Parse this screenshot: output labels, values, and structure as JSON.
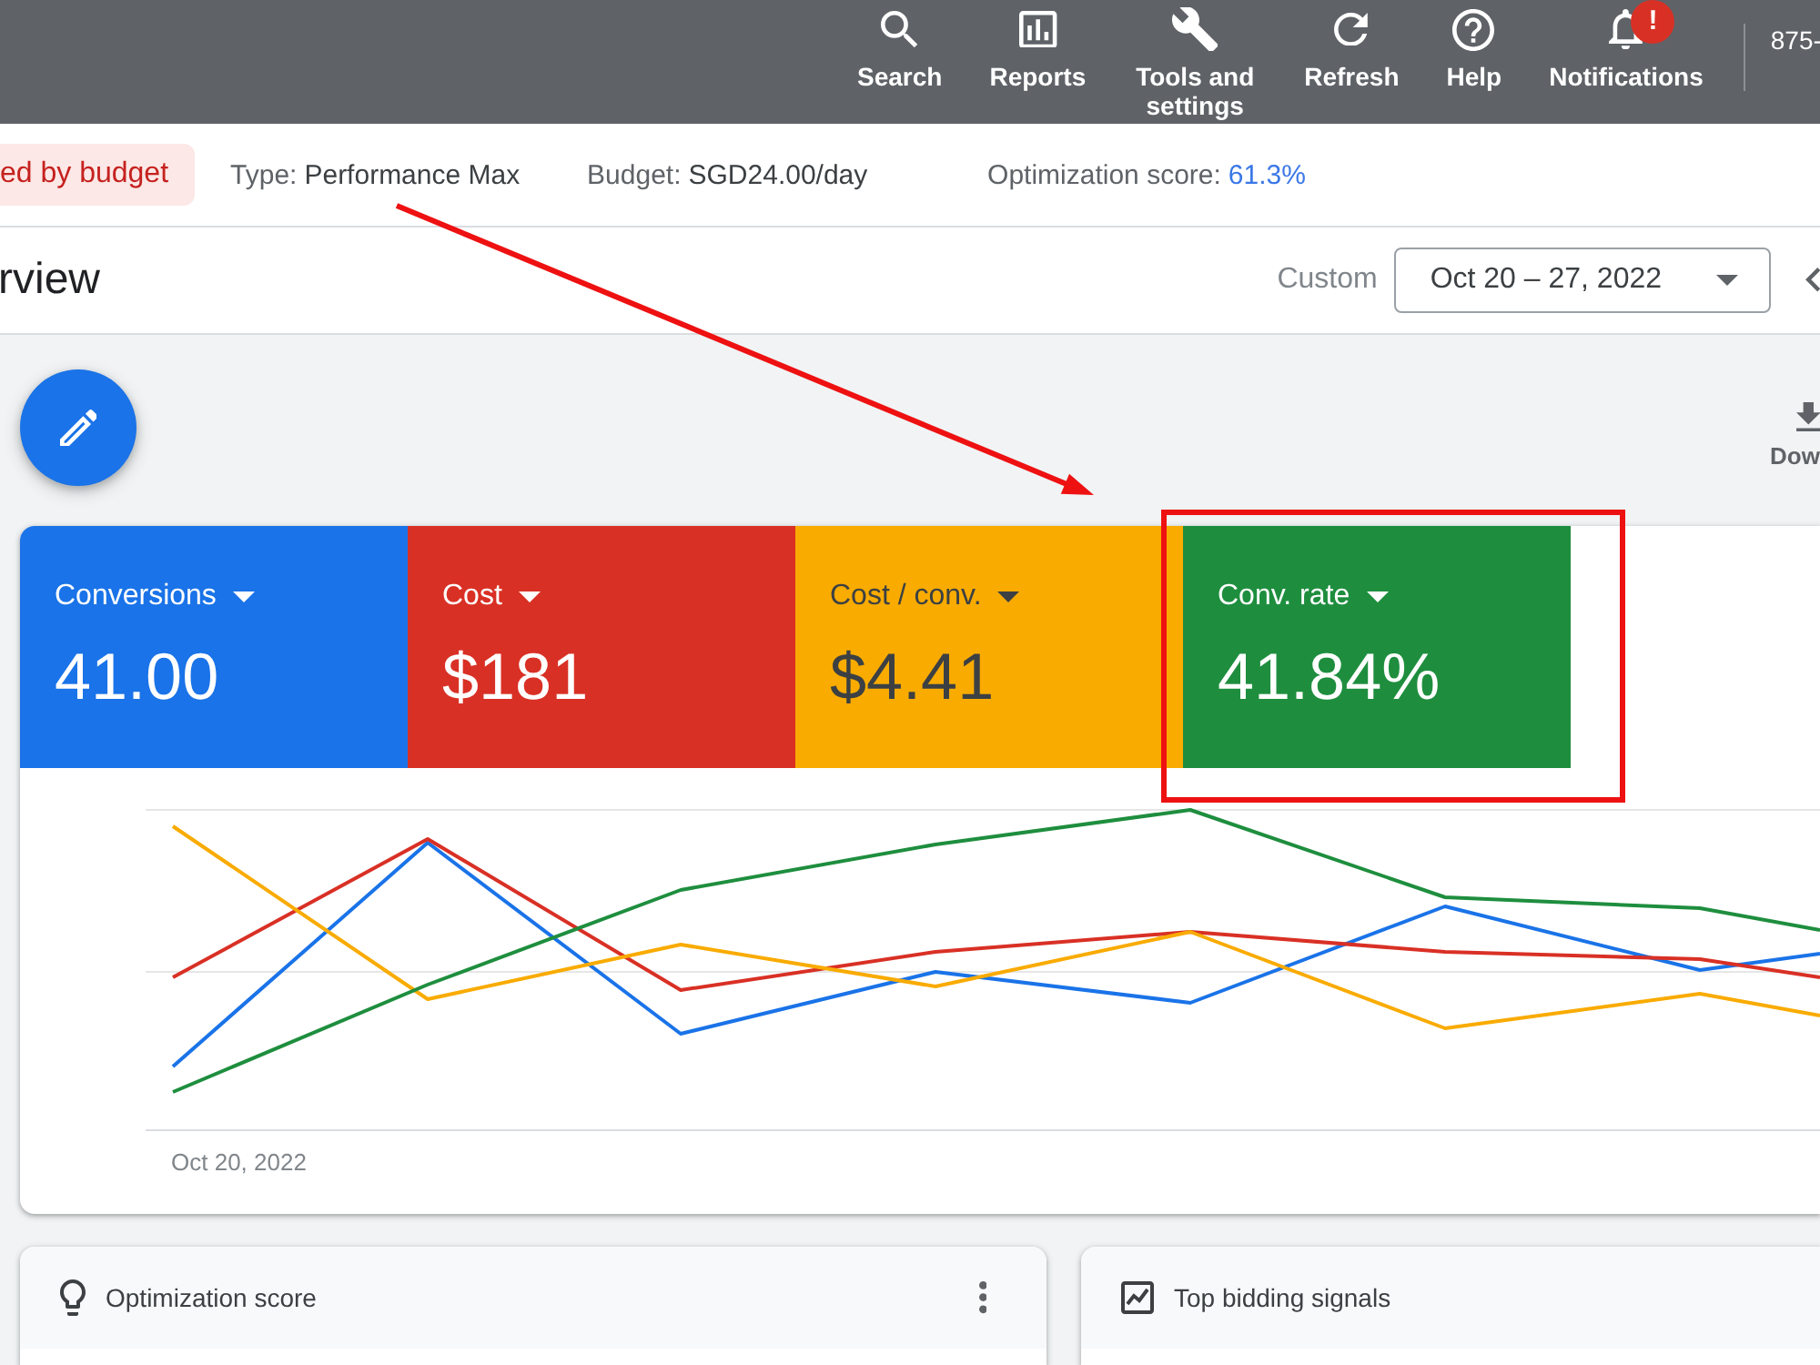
{
  "top_bar": {
    "nav_items": [
      {
        "label": "Search"
      },
      {
        "label": "Reports"
      },
      {
        "label": "Tools and settings"
      },
      {
        "label": "Refresh"
      },
      {
        "label": "Help"
      },
      {
        "label": "Notifications",
        "badge": "!"
      }
    ],
    "account": "875-"
  },
  "summary": {
    "status_chip": "ed by budget",
    "items": [
      {
        "label": "Type:",
        "value": "Performance Max",
        "kind": "plain"
      },
      {
        "label": "Budget:",
        "value": "SGD24.00/day",
        "kind": "plain"
      },
      {
        "label": "Optimization score:",
        "value": "61.3%",
        "kind": "score"
      }
    ]
  },
  "overview": {
    "title": "rview",
    "date_preset": "Custom",
    "date_range": "Oct 20 – 27, 2022"
  },
  "actions": {
    "download_label": "Dow"
  },
  "performance": {
    "metrics": [
      {
        "label": "Conversions",
        "value": "41.00",
        "color": "#1a73e8",
        "selected": true
      },
      {
        "label": "Cost",
        "value": "$181",
        "color": "#d93025",
        "selected": true
      },
      {
        "label": "Cost / conv.",
        "value": "$4.41",
        "color": "#f9ab00",
        "selected": true
      },
      {
        "label": "Conv. rate",
        "value": "41.84%",
        "color": "#1e8e3e",
        "selected": true
      }
    ],
    "x_axis_start": "Oct 20, 2022"
  },
  "cards": [
    {
      "title": "Optimization score",
      "has_menu": true
    },
    {
      "title": "Top bidding signals",
      "has_menu": false
    }
  ]
}
